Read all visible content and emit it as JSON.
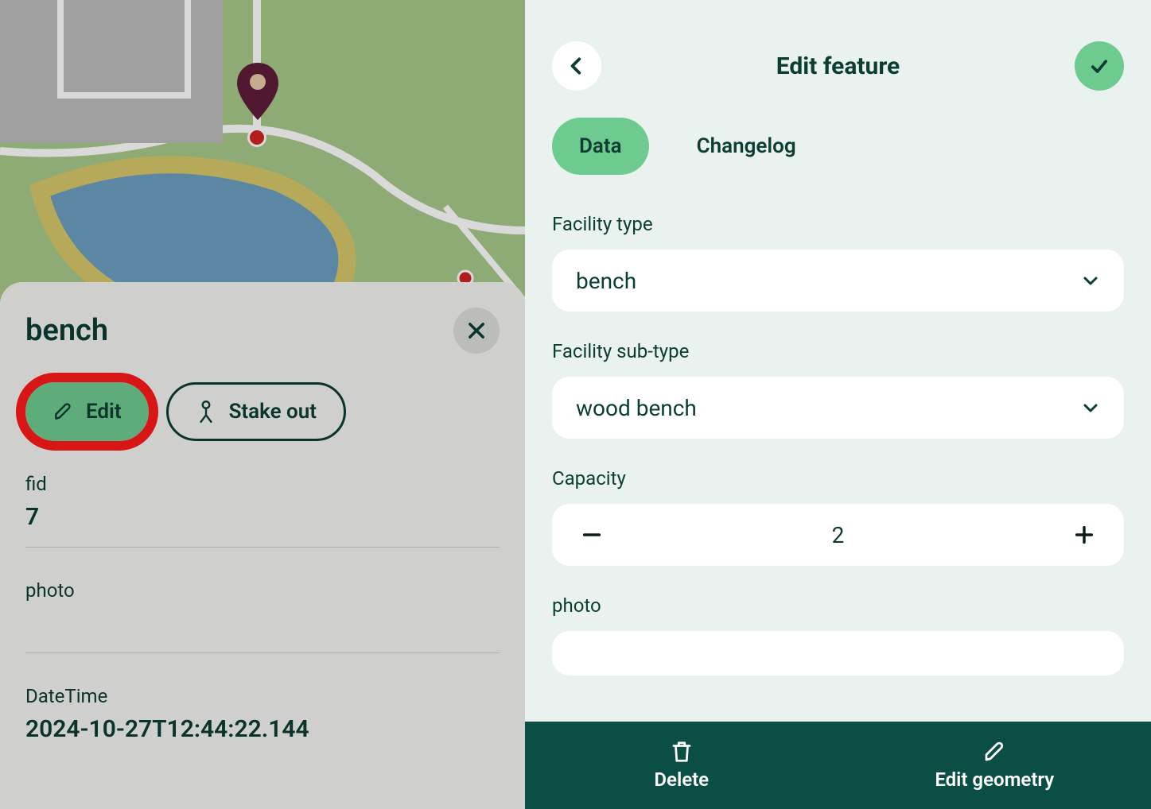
{
  "left": {
    "feature_title": "bench",
    "edit_label": "Edit",
    "stake_label": "Stake out",
    "fields": {
      "fid_label": "fid",
      "fid_value": "7",
      "photo_label": "photo",
      "datetime_label": "DateTime",
      "datetime_value": "2024-10-27T12:44:22.144"
    }
  },
  "right": {
    "title": "Edit feature",
    "tabs": {
      "data": "Data",
      "changelog": "Changelog"
    },
    "facility_type_label": "Facility type",
    "facility_type_value": "bench",
    "facility_subtype_label": "Facility sub-type",
    "facility_subtype_value": "wood bench",
    "capacity_label": "Capacity",
    "capacity_value": "2",
    "photo_label": "photo",
    "bottom": {
      "delete": "Delete",
      "edit_geometry": "Edit geometry"
    }
  }
}
